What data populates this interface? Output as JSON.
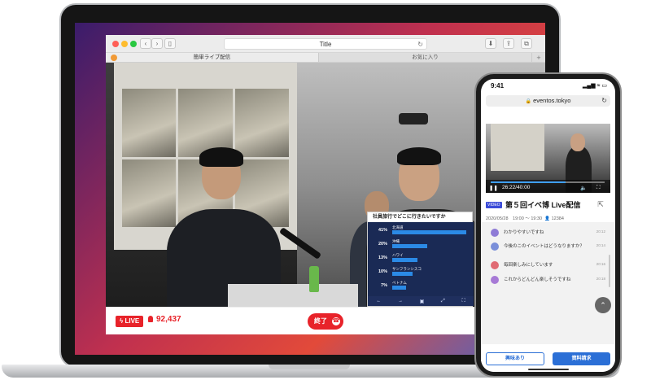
{
  "laptop": {
    "browser": {
      "title": "Title",
      "tabs": [
        {
          "label": "簡単ライブ配信",
          "active": true
        },
        {
          "label": "お気に入り",
          "active": false
        }
      ],
      "new_tab": "+"
    },
    "poll": {
      "title": "社員旅行でどこに行きたいですか",
      "options": [
        {
          "pct": "41%",
          "label": "北海道",
          "value": 0.95
        },
        {
          "pct": "20%",
          "label": "沖縄",
          "value": 0.45
        },
        {
          "pct": "13%",
          "label": "ハワイ",
          "value": 0.32
        },
        {
          "pct": "10%",
          "label": "サンフランシスコ",
          "value": 0.26
        },
        {
          "pct": "7%",
          "label": "ベトナム",
          "value": 0.18
        }
      ],
      "controls": [
        "←",
        "→",
        "▣",
        "⤢",
        "⛶"
      ]
    },
    "live_bar": {
      "live_label": "LIVE",
      "viewer_count": "92,437",
      "end_label": "終了"
    }
  },
  "phone": {
    "status_time": "9:41",
    "status_icons": "▂▄▆ ≈ ▭",
    "url": "eventos.tokyo",
    "video": {
      "time": "26:22/40:00",
      "progress": 0.66
    },
    "event": {
      "tag": "VIDEO",
      "title": "第５回イベ博 Live配信",
      "date": "2020/05/28　19:00 ～ 19:30",
      "viewers": "12384"
    },
    "chat": [
      {
        "text": "わかりやすいですね",
        "time": "20:12",
        "color": "#8e7bd6"
      },
      {
        "text": "今後のこのイベントはどうなりますか？",
        "time": "20:14",
        "color": "#7a8fd9"
      },
      {
        "text": "毎回楽しみにしています",
        "time": "20:16",
        "color": "#e06b74"
      },
      {
        "text": "これからどんどん楽しそうですね",
        "time": "20:18",
        "color": "#a77ad6"
      }
    ],
    "buttons": {
      "interest": "興味あり",
      "docs": "資料請求"
    }
  },
  "colors": {
    "live_red": "#e8232a",
    "accent_blue": "#2b6fd6"
  }
}
